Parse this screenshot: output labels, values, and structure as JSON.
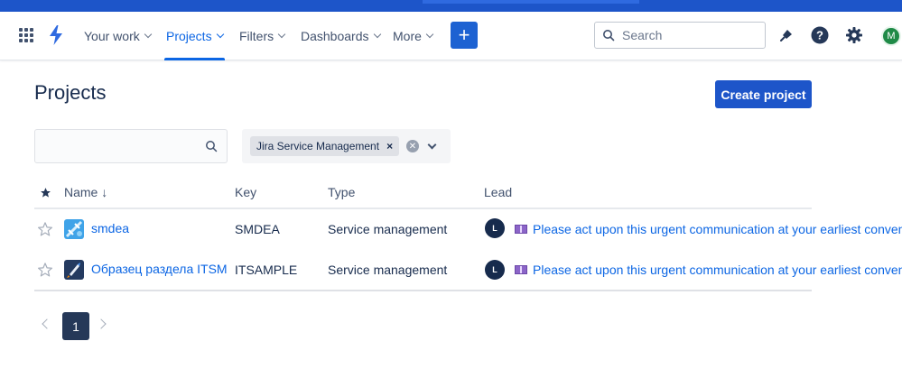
{
  "nav": {
    "your_work": "Your work",
    "projects": "Projects",
    "filters": "Filters",
    "dashboards": "Dashboards",
    "more": "More",
    "create_plus": "+",
    "search_placeholder": "Search",
    "avatar_initial": "M",
    "accent_color": "#0c66e4"
  },
  "page": {
    "title": "Projects",
    "create_button": "Create project"
  },
  "filters": {
    "search_value": "",
    "product_chip": "Jira Service Management",
    "chip_remove": "×"
  },
  "table": {
    "headers": {
      "name": "Name",
      "key": "Key",
      "type": "Type",
      "lead": "Lead"
    },
    "sort_indicator": "↓",
    "rows": [
      {
        "name": "smdea",
        "key": "SMDEA",
        "type": "Service management",
        "lead_initial": "L",
        "lead_name": "Please act upon this urgent communication at your earliest convenience"
      },
      {
        "name": "Образец раздела ITSM",
        "key": "ITSAMPLE",
        "type": "Service management",
        "lead_initial": "L",
        "lead_name": "Please act upon this urgent communication at your earliest convenience"
      }
    ]
  },
  "pagination": {
    "current_page": "1"
  }
}
